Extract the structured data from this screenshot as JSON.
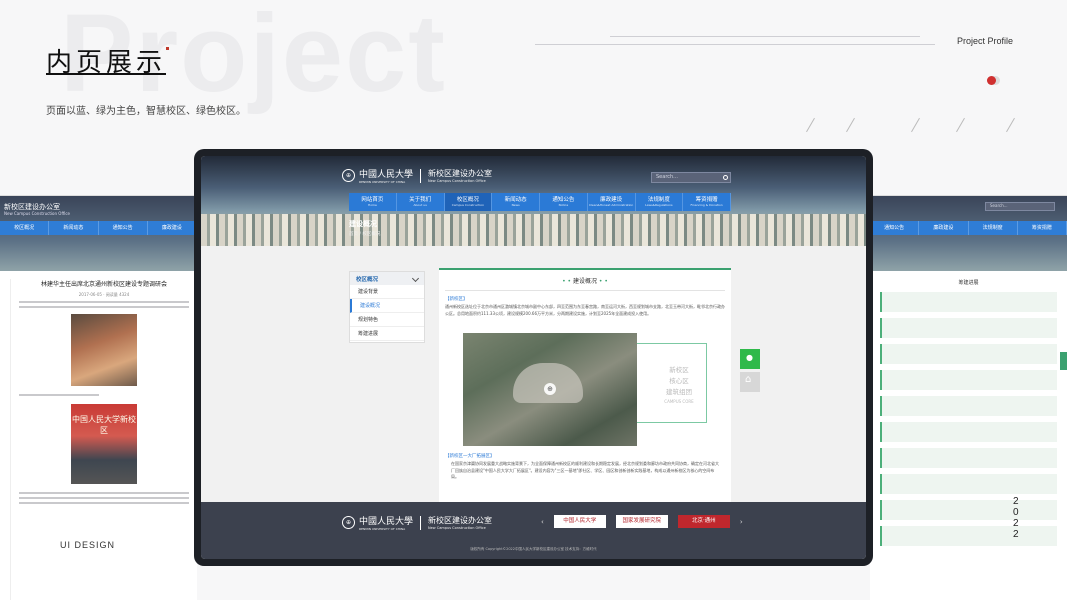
{
  "page": {
    "title": "内页展示",
    "subtitle": "页面以蓝、绿为主色，智慧校区、绿色校区。",
    "profile": "Project Profile",
    "watermark": "Project",
    "year_digits": [
      "2",
      "0",
      "2",
      "2"
    ],
    "ui_label": "UI DESIGN"
  },
  "site": {
    "univ_cn": "中國人民大學",
    "univ_en": "RENMIN UNIVERSITY OF CHINA",
    "office_cn": "新校区建设办公室",
    "office_en": "New Campus Construction Office",
    "search_placeholder": "Search...",
    "nav": [
      {
        "cn": "网站首页",
        "en": "Home"
      },
      {
        "cn": "关于我们",
        "en": "About us"
      },
      {
        "cn": "校区概况",
        "en": "Campus Construction"
      },
      {
        "cn": "新闻动态",
        "en": "News"
      },
      {
        "cn": "通知公告",
        "en": "Notice"
      },
      {
        "cn": "廉政建设",
        "en": "Clean&Honest Administration"
      },
      {
        "cn": "法规制度",
        "en": "Laws&Regulations"
      },
      {
        "cn": "筹资捐赠",
        "en": "Financing & Donation"
      }
    ],
    "page_heading": "建设概况",
    "breadcrumb": "首页 / 校区概况",
    "side_menu": {
      "title": "校区概况",
      "items": [
        "建设背景",
        "建设概况",
        "规划特色",
        "筹建进展"
      ]
    },
    "content": {
      "title": "建设概况",
      "tag1": "【新校区】",
      "para1": "通州新校区选址位于北京市通州区潞城镇北京城市副中心东部，四至范围为东至春宫路，南至运河大街，西至规划城市支路，北至玉带河大街，毗邻北京行政办公区。总用地面积约111.33公顷，建设规模200.66万平方米，分两期建设实施，计划至2025年全面建成投入使用。",
      "img_caption": [
        "新校区",
        "核心区",
        "建筑组团"
      ],
      "img_caption_en": "CAMPUS CORE",
      "tag2": "【新校区一大厂拓展区】",
      "para2": "在国家京津冀协同发展重大战略实施背景下，为全面保障通州新校区的顺利建设和长期稳定发展，经北京规划委和廊坊市政府共同协商，确定在河北省大厂回族自治县建设\"中国人民大学大厂拓展区\"。建设内容为\"三区一基地\"即社区、学区、园区和创新创新实践基地，构成以通州新校区为核心的空间布局。"
    },
    "footer": {
      "links": [
        "中国人民大学",
        "国家发展研究院",
        "北京·通州"
      ],
      "copyright": "版权所有 Copyright©2022中国人民大学新校区建设办公室   技术支持：方维时代"
    }
  },
  "left_panel": {
    "office_cn": "新校区建设办公室",
    "office_en": "New Campus Construction Office",
    "nav": [
      "校区概况",
      "新闻动态",
      "通知公告",
      "廉政建设"
    ],
    "article_title": "林建华主任出席北京通州新校区建设专题调研会",
    "article_meta": "2017-06-05   ·   阅读量 4324",
    "photo_caption": "中国人民大学新校区"
  },
  "right_panel": {
    "search_placeholder": "Search...",
    "nav": [
      "通知公告",
      "廉政建设",
      "法规制度",
      "筹资捐赠"
    ],
    "heading": "筹建进展"
  },
  "colors": {
    "primary_blue": "#2b7ad6",
    "accent_green": "#3ba170",
    "footer_bg": "#3c414e"
  }
}
